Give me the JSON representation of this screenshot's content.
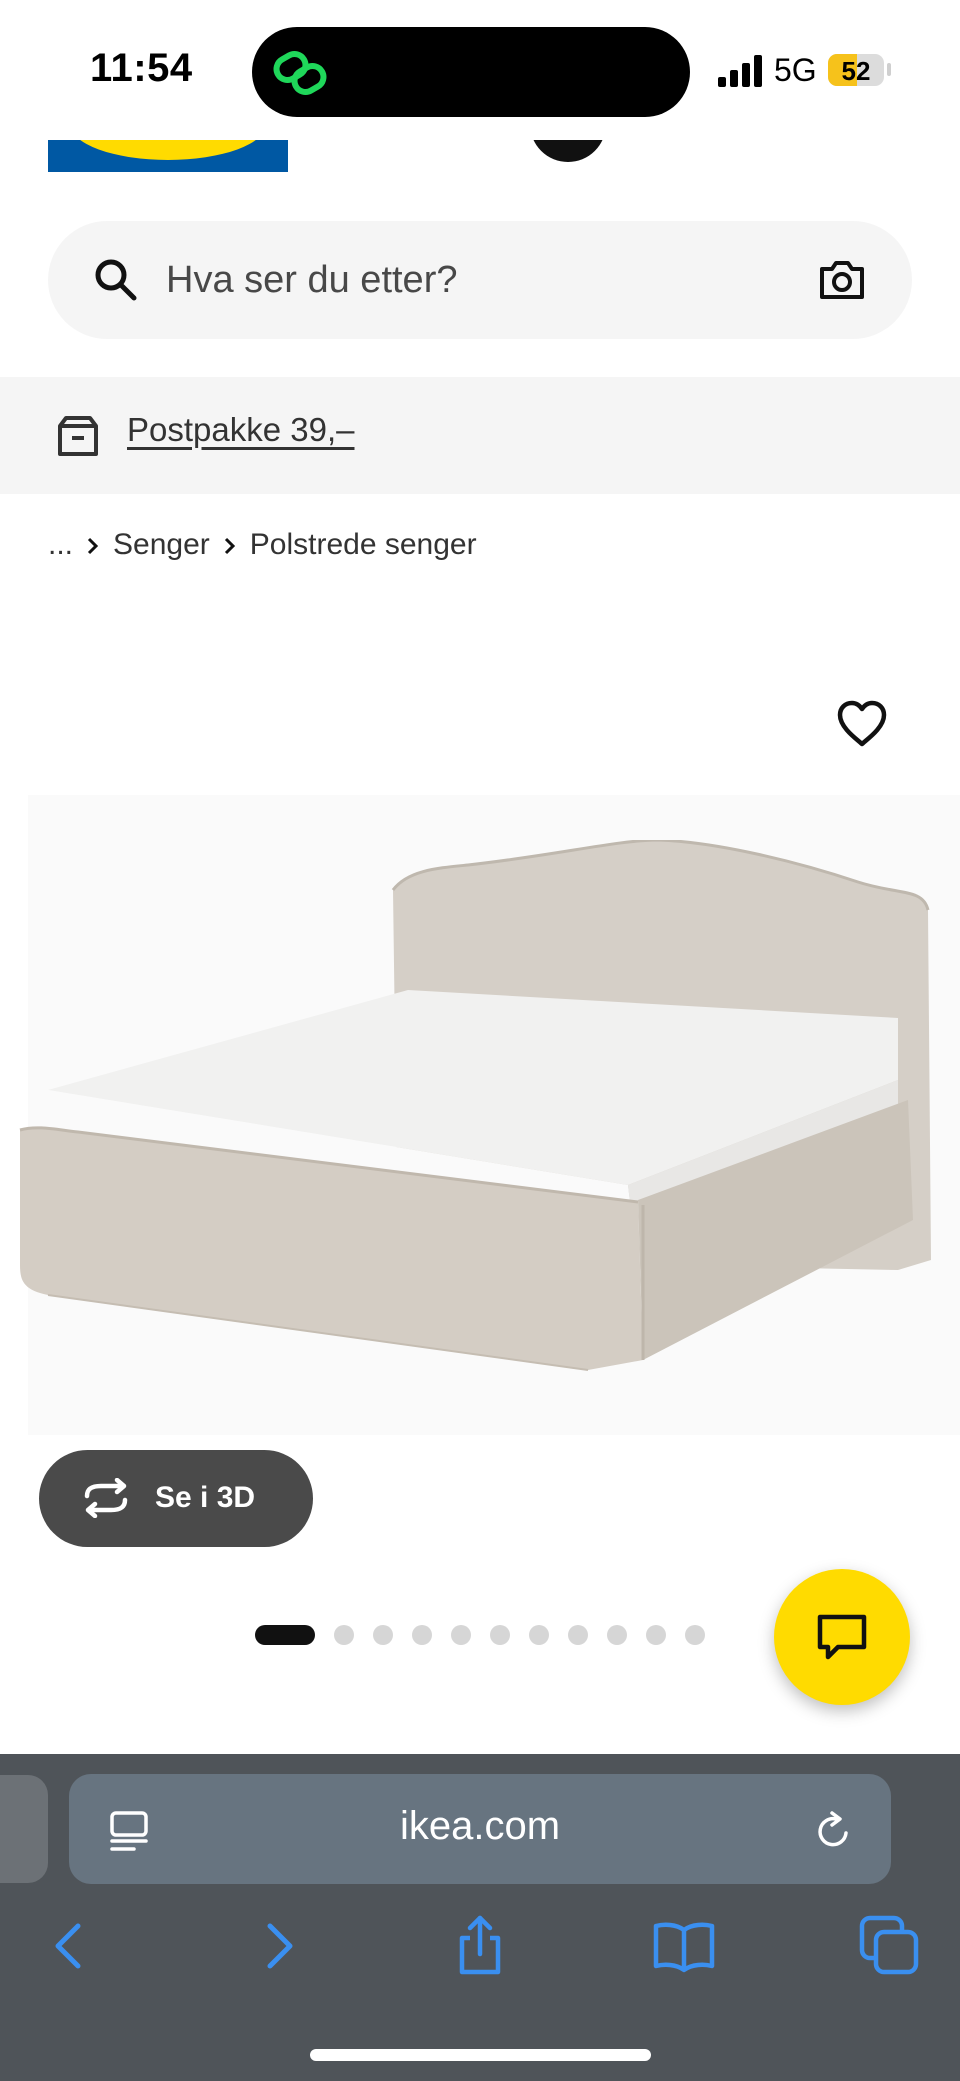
{
  "status_bar": {
    "time": "11:54",
    "network": "5G",
    "battery_level": "52",
    "battery_fraction": 0.52
  },
  "search": {
    "placeholder": "Hva ser du etter?"
  },
  "delivery": {
    "link_text": "Postpakke 39,–"
  },
  "breadcrumb": {
    "items": [
      "...",
      "Senger",
      "Polstrede senger"
    ]
  },
  "product_viewer": {
    "view_3d_label": "Se i 3D",
    "carousel_count": 11,
    "carousel_active_index": 0
  },
  "browser": {
    "url": "ikea.com"
  },
  "colors": {
    "brand_blue": "#0058a3",
    "brand_yellow": "#ffdb00",
    "safari_accent": "#3a8ff0"
  }
}
